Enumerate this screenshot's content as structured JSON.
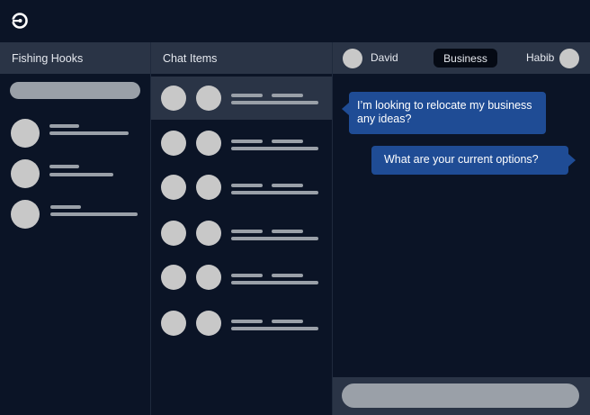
{
  "app": {
    "logo_icon": "app-logo-icon"
  },
  "left_panel": {
    "title": "Fishing Hooks",
    "items": [
      {},
      {},
      {}
    ]
  },
  "middle_panel": {
    "title": "Chat Items",
    "items": [
      {
        "active": true
      },
      {},
      {},
      {},
      {},
      {}
    ]
  },
  "chat": {
    "participant_left": "David",
    "topic": "Business",
    "participant_right": "Habib",
    "messages": [
      {
        "from": "David",
        "text": "I’m looking to relocate my business any ideas?"
      },
      {
        "from": "Habib",
        "text": "What are your current options?"
      }
    ]
  },
  "colors": {
    "background": "#0b1426",
    "panel_header": "#2a3446",
    "bubble": "#1f4c95",
    "placeholder": "#9aa0a8",
    "avatar": "#c8c8c8"
  }
}
